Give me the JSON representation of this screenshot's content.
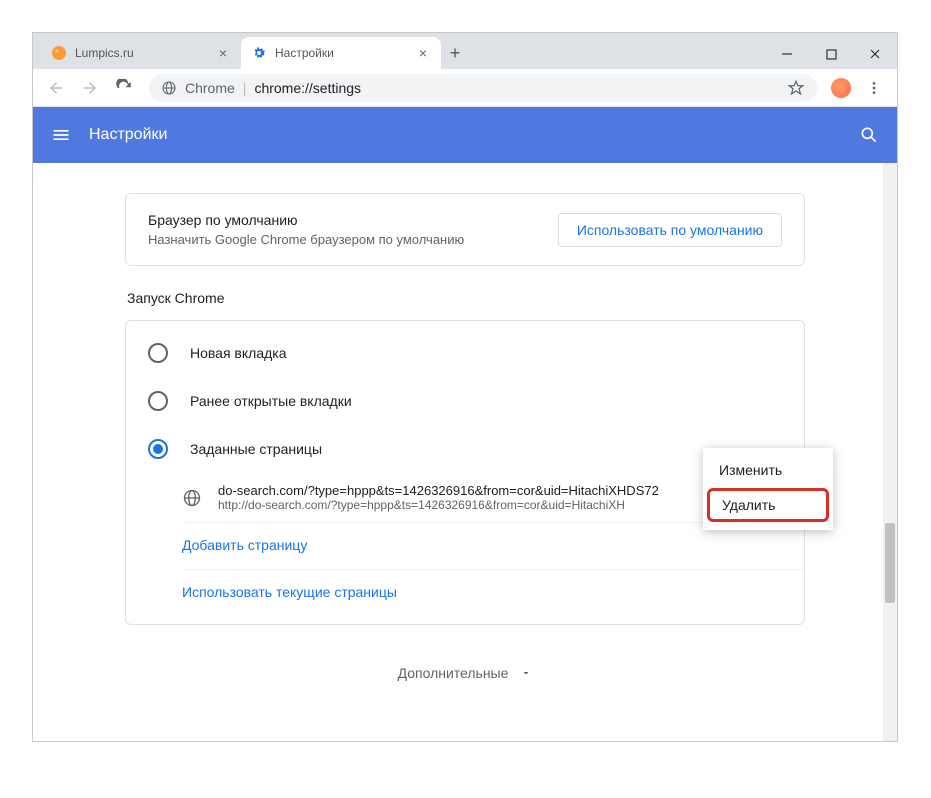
{
  "window": {
    "tabs": [
      {
        "title": "Lumpics.ru",
        "active": false
      },
      {
        "title": "Настройки",
        "active": true
      }
    ],
    "url_label": "Chrome",
    "url_path": "chrome://settings"
  },
  "header": {
    "title": "Настройки"
  },
  "default_browser": {
    "title": "Браузер по умолчанию",
    "subtitle": "Назначить Google Chrome браузером по умолчанию",
    "button": "Использовать по умолчанию"
  },
  "startup": {
    "section_title": "Запуск Chrome",
    "options": [
      {
        "label": "Новая вкладка",
        "selected": false
      },
      {
        "label": "Ранее открытые вкладки",
        "selected": false
      },
      {
        "label": "Заданные страницы",
        "selected": true
      }
    ],
    "pages": [
      {
        "title": "do-search.com/?type=hppp&ts=1426326916&from=cor&uid=HitachiXHDS72",
        "url": "http://do-search.com/?type=hppp&ts=1426326916&from=cor&uid=HitachiXH"
      }
    ],
    "add_page": "Добавить страницу",
    "use_current": "Использовать текущие страницы"
  },
  "context_menu": {
    "edit": "Изменить",
    "delete": "Удалить"
  },
  "advanced_label": "Дополнительные"
}
